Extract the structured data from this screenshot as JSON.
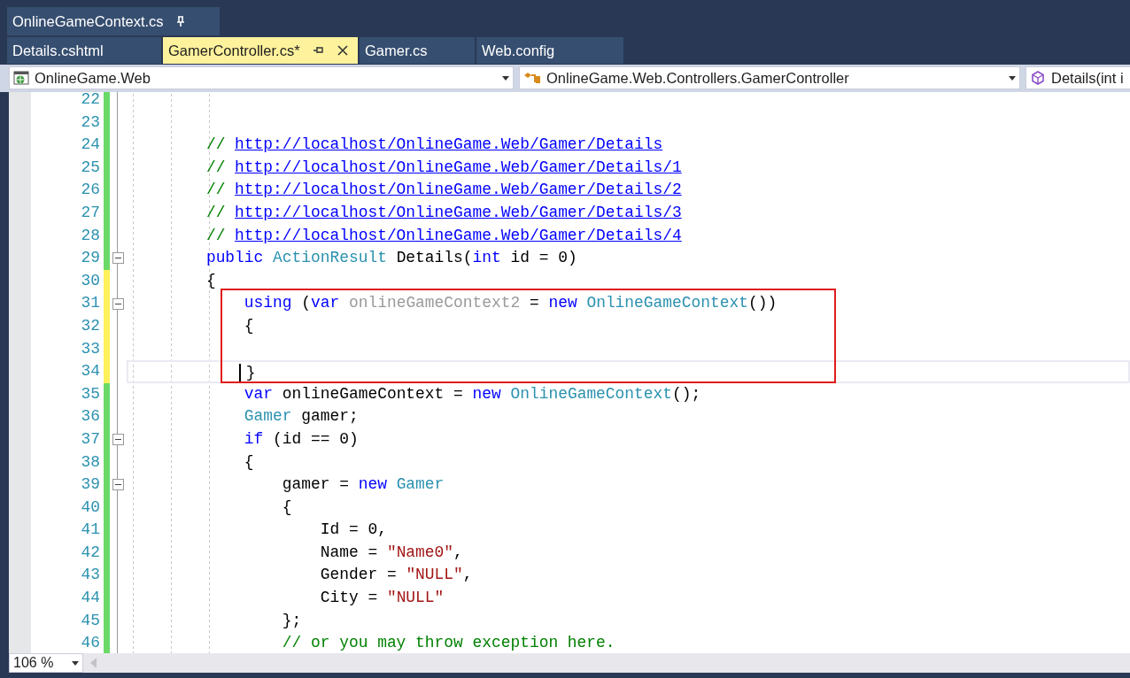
{
  "pinned_tabs": [
    {
      "label": "OnlineGameContext.cs",
      "pinned": true
    }
  ],
  "tabs": [
    {
      "label": "Details.cshtml",
      "selected": false
    },
    {
      "label": "GamerController.cs*",
      "selected": true
    },
    {
      "label": "Gamer.cs",
      "selected": false
    },
    {
      "label": "Web.config",
      "selected": false
    }
  ],
  "navigation": [
    {
      "kind": "project",
      "label": "OnlineGame.Web"
    },
    {
      "kind": "class",
      "label": "OnlineGame.Web.Controllers.GamerController"
    },
    {
      "kind": "method",
      "label": "Details(int i"
    }
  ],
  "lines": [
    {
      "number": "22",
      "saved": true,
      "fold": false,
      "current": false
    },
    {
      "number": "23",
      "saved": true,
      "fold": false,
      "current": false
    },
    {
      "number": "24",
      "saved": true,
      "fold": false,
      "current": false,
      "tokens": [
        {
          "kind": "comment",
          "text": "        // "
        },
        {
          "kind": "link",
          "text": "http://localhost/OnlineGame.Web/Gamer/Details"
        }
      ]
    },
    {
      "number": "25",
      "saved": true,
      "fold": false,
      "current": false,
      "tokens": [
        {
          "kind": "comment",
          "text": "        // "
        },
        {
          "kind": "link",
          "text": "http://localhost/OnlineGame.Web/Gamer/Details/1"
        }
      ]
    },
    {
      "number": "26",
      "saved": true,
      "fold": false,
      "current": false,
      "tokens": [
        {
          "kind": "comment",
          "text": "        // "
        },
        {
          "kind": "link",
          "text": "http://localhost/OnlineGame.Web/Gamer/Details/2"
        }
      ]
    },
    {
      "number": "27",
      "saved": true,
      "fold": false,
      "current": false,
      "tokens": [
        {
          "kind": "comment",
          "text": "        // "
        },
        {
          "kind": "link",
          "text": "http://localhost/OnlineGame.Web/Gamer/Details/3"
        }
      ]
    },
    {
      "number": "28",
      "saved": true,
      "fold": false,
      "current": false,
      "tokens": [
        {
          "kind": "comment",
          "text": "        // "
        },
        {
          "kind": "link",
          "text": "http://localhost/OnlineGame.Web/Gamer/Details/4"
        }
      ]
    },
    {
      "number": "29",
      "saved": true,
      "fold": true,
      "current": false,
      "tokens": [
        {
          "kind": "keyword",
          "text": "        public"
        },
        {
          "kind": "type",
          "text": " ActionResult"
        },
        {
          "kind": "plain",
          "text": " Details("
        },
        {
          "kind": "keyword",
          "text": "int"
        },
        {
          "kind": "plain",
          "text": " id = 0)"
        }
      ]
    },
    {
      "number": "30",
      "saved": false,
      "fold": false,
      "current": false,
      "tokens": [
        {
          "kind": "plain",
          "text": "        {"
        }
      ]
    },
    {
      "number": "31",
      "saved": false,
      "fold": true,
      "current": false,
      "tokens": [
        {
          "kind": "keyword",
          "text": "            using"
        },
        {
          "kind": "plain",
          "text": " ("
        },
        {
          "kind": "keyword",
          "text": "var"
        },
        {
          "kind": "unused",
          "text": " onlineGameContext2"
        },
        {
          "kind": "plain",
          "text": " = "
        },
        {
          "kind": "keyword",
          "text": "new"
        },
        {
          "kind": "type",
          "text": " OnlineGameContext"
        },
        {
          "kind": "plain",
          "text": "())"
        }
      ]
    },
    {
      "number": "32",
      "saved": false,
      "fold": false,
      "current": false,
      "tokens": [
        {
          "kind": "plain",
          "text": "            {"
        }
      ]
    },
    {
      "number": "33",
      "saved": false,
      "fold": false,
      "current": false
    },
    {
      "number": "34",
      "saved": false,
      "fold": false,
      "current": true,
      "tokens": [
        {
          "kind": "plain",
          "text": "            }"
        }
      ]
    },
    {
      "number": "35",
      "saved": true,
      "fold": false,
      "current": false,
      "tokens": [
        {
          "kind": "keyword",
          "text": "            var"
        },
        {
          "kind": "plain",
          "text": " onlineGameContext = "
        },
        {
          "kind": "keyword",
          "text": "new"
        },
        {
          "kind": "type",
          "text": " OnlineGameContext"
        },
        {
          "kind": "plain",
          "text": "();"
        }
      ]
    },
    {
      "number": "36",
      "saved": true,
      "fold": false,
      "current": false,
      "tokens": [
        {
          "kind": "type",
          "text": "            Gamer"
        },
        {
          "kind": "plain",
          "text": " gamer;"
        }
      ]
    },
    {
      "number": "37",
      "saved": true,
      "fold": true,
      "current": false,
      "tokens": [
        {
          "kind": "keyword",
          "text": "            if"
        },
        {
          "kind": "plain",
          "text": " (id == 0)"
        }
      ]
    },
    {
      "number": "38",
      "saved": true,
      "fold": false,
      "current": false,
      "tokens": [
        {
          "kind": "plain",
          "text": "            {"
        }
      ]
    },
    {
      "number": "39",
      "saved": true,
      "fold": true,
      "current": false,
      "tokens": [
        {
          "kind": "plain",
          "text": "                gamer = "
        },
        {
          "kind": "keyword",
          "text": "new"
        },
        {
          "kind": "type",
          "text": " Gamer"
        }
      ]
    },
    {
      "number": "40",
      "saved": true,
      "fold": false,
      "current": false,
      "tokens": [
        {
          "kind": "plain",
          "text": "                {"
        }
      ]
    },
    {
      "number": "41",
      "saved": true,
      "fold": false,
      "current": false,
      "tokens": [
        {
          "kind": "plain",
          "text": "                    Id = 0,"
        }
      ]
    },
    {
      "number": "42",
      "saved": true,
      "fold": false,
      "current": false,
      "tokens": [
        {
          "kind": "plain",
          "text": "                    Name = "
        },
        {
          "kind": "string",
          "text": "\"Name0\""
        },
        {
          "kind": "plain",
          "text": ","
        }
      ]
    },
    {
      "number": "43",
      "saved": true,
      "fold": false,
      "current": false,
      "tokens": [
        {
          "kind": "plain",
          "text": "                    Gender = "
        },
        {
          "kind": "string",
          "text": "\"NULL\""
        },
        {
          "kind": "plain",
          "text": ","
        }
      ]
    },
    {
      "number": "44",
      "saved": true,
      "fold": false,
      "current": false,
      "tokens": [
        {
          "kind": "plain",
          "text": "                    City = "
        },
        {
          "kind": "string",
          "text": "\"NULL\""
        }
      ]
    },
    {
      "number": "45",
      "saved": true,
      "fold": false,
      "current": false,
      "tokens": [
        {
          "kind": "plain",
          "text": "                };"
        }
      ]
    },
    {
      "number": "46",
      "saved": true,
      "fold": false,
      "current": false,
      "tokens": [
        {
          "kind": "comment",
          "text": "                // or you may throw exception here."
        }
      ]
    }
  ],
  "zoom": {
    "value": "106 %"
  }
}
